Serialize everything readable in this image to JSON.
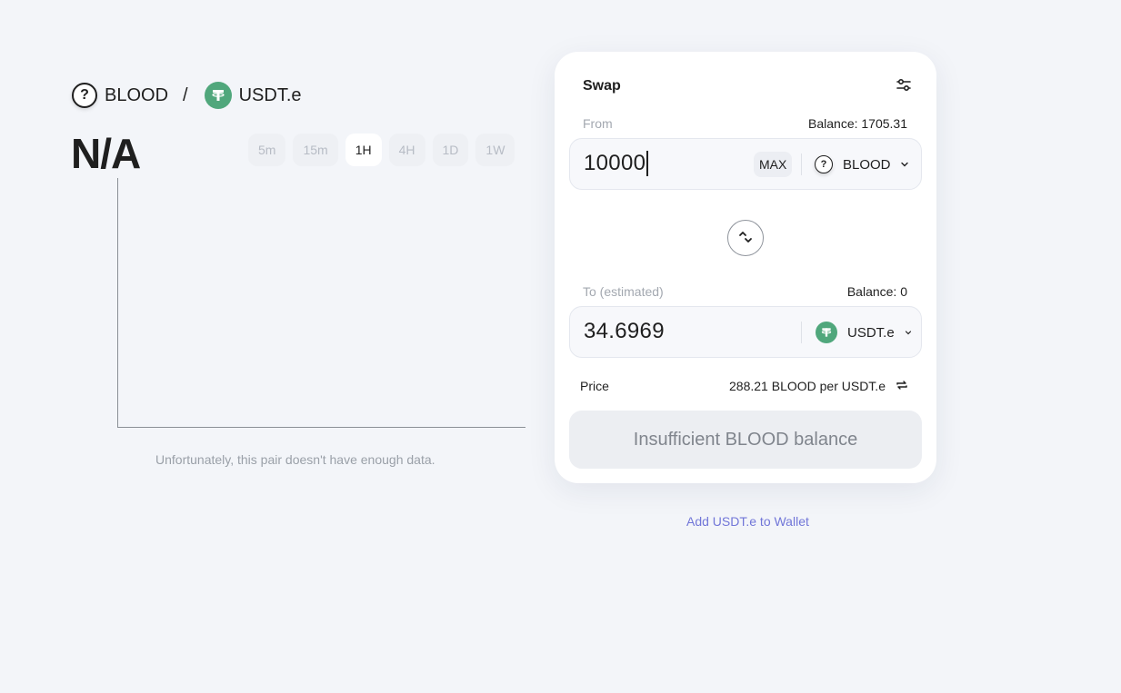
{
  "pair": {
    "base_symbol": "BLOOD",
    "base_icon": "question-icon",
    "separator": "/",
    "quote_symbol": "USDT.e",
    "quote_icon": "tether-icon",
    "quote_color": "#50a77c"
  },
  "price_display": "N/A",
  "timeframes": [
    {
      "label": "5m",
      "active": false
    },
    {
      "label": "15m",
      "active": false
    },
    {
      "label": "1H",
      "active": true
    },
    {
      "label": "4H",
      "active": false
    },
    {
      "label": "1D",
      "active": false
    },
    {
      "label": "1W",
      "active": false
    }
  ],
  "chart": {
    "empty_message": "Unfortunately, this pair doesn't have enough data."
  },
  "swap": {
    "title": "Swap",
    "settings_icon": "sliders-icon",
    "from": {
      "label": "From",
      "balance": "Balance: 1705.31",
      "amount": "10000",
      "max_label": "MAX",
      "token": "BLOOD",
      "token_icon": "question-icon"
    },
    "flip_icon": "swap-vertical-icon",
    "to": {
      "label": "To (estimated)",
      "balance": "Balance: 0",
      "amount": "34.6969",
      "token": "USDT.e",
      "token_icon": "tether-icon"
    },
    "price": {
      "label": "Price",
      "value": "288.21 BLOOD per USDT.e",
      "toggle_icon": "refresh-arrows-icon"
    },
    "submit_label": "Insufficient BLOOD balance"
  },
  "add_wallet_link": "Add USDT.e to Wallet",
  "colors": {
    "background": "#f3f5f9",
    "tether_green": "#50a77c",
    "link": "#7176d8",
    "disabled_button": "#eceef2"
  }
}
